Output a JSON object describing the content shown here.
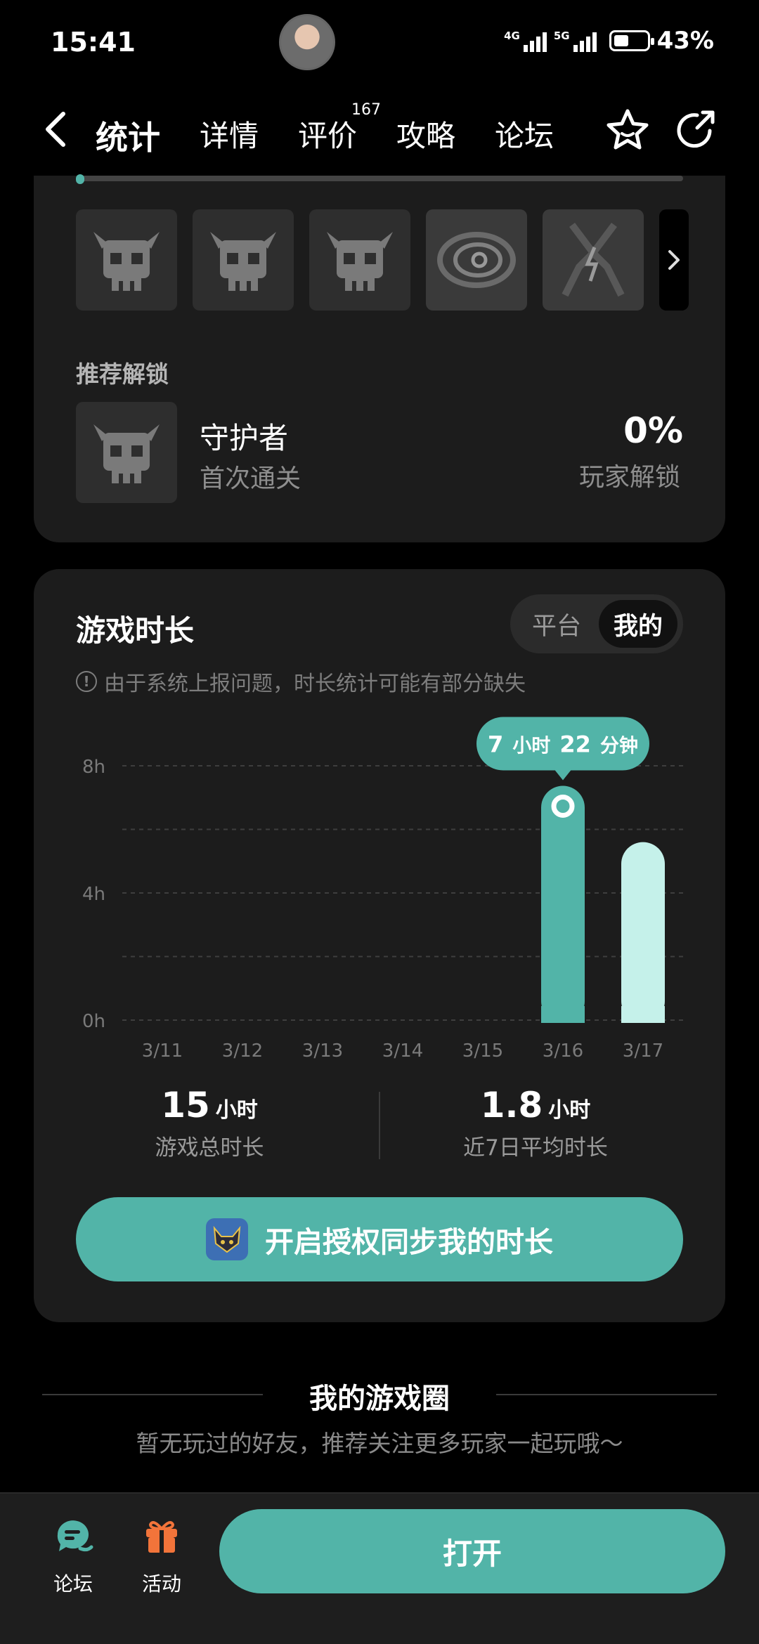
{
  "status_bar": {
    "time": "15:41",
    "net1": "4G",
    "net2": "5G",
    "battery": "43%"
  },
  "nav": {
    "tabs": [
      {
        "label": "统计",
        "active": true
      },
      {
        "label": "详情"
      },
      {
        "label": "评价",
        "badge": "167"
      },
      {
        "label": "攻略"
      },
      {
        "label": "论坛"
      }
    ],
    "icons": [
      "back-icon",
      "star-icon",
      "share-icon"
    ]
  },
  "achievements": {
    "tiles": [
      "skull-icon",
      "skull-icon",
      "skull-icon",
      "vortex-icon",
      "lightning-icon"
    ],
    "recommend_label": "推荐解锁",
    "recommended": {
      "name": "守护者",
      "desc": "首次通关",
      "percent": "0%",
      "percent_label": "玩家解锁"
    }
  },
  "playtime": {
    "title": "游戏时长",
    "segments": {
      "platform": "平台",
      "mine": "我的",
      "selected": "我的"
    },
    "notice": "由于系统上报问题，时长统计可能有部分缺失",
    "tooltip": {
      "h": "7",
      "h_unit": "小时",
      "m": "22",
      "m_unit": "分钟"
    },
    "total": {
      "value": "15",
      "unit": "小时",
      "label": "游戏总时长"
    },
    "average": {
      "value": "1.8",
      "unit": "小时",
      "label": "近7日平均时长"
    },
    "sync_button": "开启授权同步我的时长"
  },
  "chart_data": {
    "type": "bar",
    "categories": [
      "3/11",
      "3/12",
      "3/13",
      "3/14",
      "3/15",
      "3/16",
      "3/17"
    ],
    "values": [
      0,
      0,
      0,
      0,
      0,
      7.37,
      5.6
    ],
    "yticks": [
      "0h",
      "4h",
      "8h"
    ],
    "ylim": [
      0,
      8
    ],
    "highlight_index": 5,
    "colors": {
      "highlight": "#52b4a8",
      "normal": "#c5f1ea"
    }
  },
  "game_circle": {
    "title": "我的游戏圈",
    "subtitle": "暂无玩过的好友，推荐关注更多玩家一起玩哦～"
  },
  "bottom_bar": {
    "forum": "论坛",
    "activity": "活动",
    "open": "打开"
  }
}
